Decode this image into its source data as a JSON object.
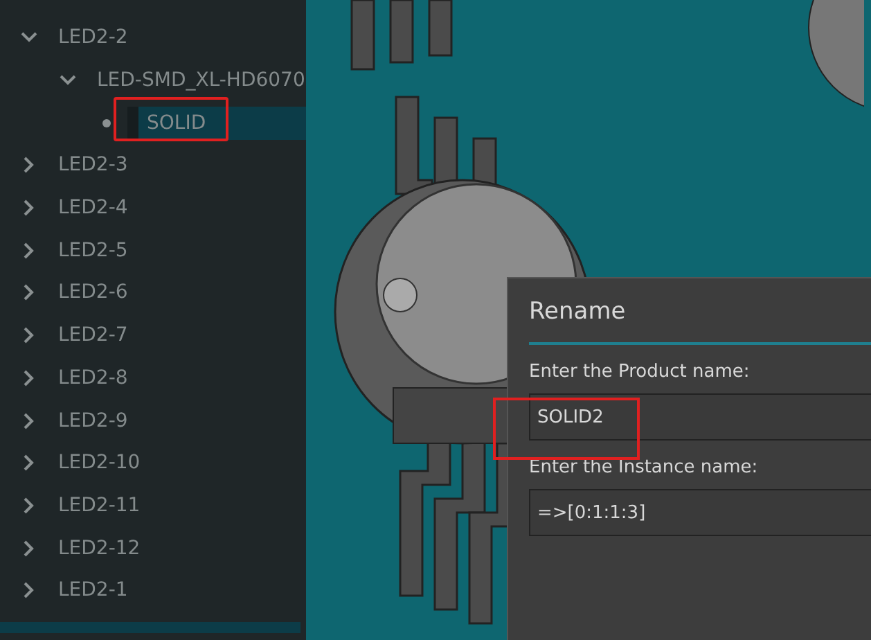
{
  "tree": [
    {
      "label": "LED2-2",
      "expanded": true,
      "selected": false,
      "children": [
        {
          "label": "LED-SMD_XL-HD6070",
          "expanded": true,
          "selected": false,
          "children": [
            {
              "label": "SOLID",
              "selected": true,
              "highlighted": true
            }
          ]
        }
      ]
    },
    {
      "label": "LED2-3",
      "expanded": false,
      "selected": false
    },
    {
      "label": "LED2-4",
      "expanded": false,
      "selected": false
    },
    {
      "label": "LED2-5",
      "expanded": false,
      "selected": false
    },
    {
      "label": "LED2-6",
      "expanded": false,
      "selected": false
    },
    {
      "label": "LED2-7",
      "expanded": false,
      "selected": false
    },
    {
      "label": "LED2-8",
      "expanded": false,
      "selected": false
    },
    {
      "label": "LED2-9",
      "expanded": false,
      "selected": false
    },
    {
      "label": "LED2-10",
      "expanded": false,
      "selected": false
    },
    {
      "label": "LED2-11",
      "expanded": false,
      "selected": false
    },
    {
      "label": "LED2-12",
      "expanded": false,
      "selected": false
    },
    {
      "label": "LED2-1",
      "expanded": false,
      "selected": false
    }
  ],
  "dialog": {
    "title": "Rename",
    "fields": [
      {
        "label": "Enter the Product name:",
        "value": "SOLID2",
        "highlighted": true
      },
      {
        "label": "Enter the Instance name:",
        "value": "=>[0:1:1:3]"
      }
    ]
  }
}
